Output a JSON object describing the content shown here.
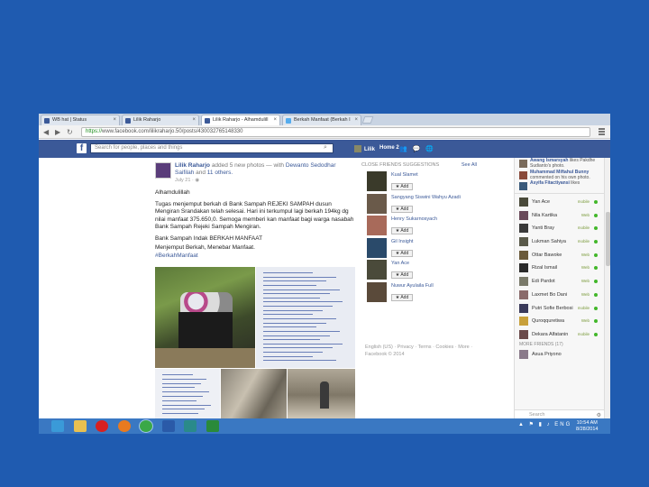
{
  "browser": {
    "tabs": [
      {
        "title": "WB hat | Status",
        "active": false
      },
      {
        "title": "Lilik Raharjo",
        "active": false
      },
      {
        "title": "Lilik Raharjo - Alhamdulill",
        "active": true
      },
      {
        "title": "Berkah Manfaat (Berkah I",
        "active": false
      }
    ],
    "url_scheme": "https://",
    "url_rest": "www.facebook.com/lilikraharjo.50/posts/430032765148330"
  },
  "fb_header": {
    "logo": "f",
    "search_placeholder": "Search for people, places and things",
    "user": "Lilik",
    "home": "Home",
    "home_count": "2"
  },
  "post": {
    "author": "Lilik Raharjo",
    "action": " added 5 new photos — with ",
    "with": "Dewanto Sedodhar Saifilah",
    "and": " and ",
    "others": "11 others.",
    "time": "July 21 · ",
    "paragraphs": [
      "Alhamdulillah",
      "Tugas menjemput berkah di Bank Sampah REJEKI SAMPAH dusun Mengiran Srandakan telah selesai. Hari ini terkumpul lagi berkah 194kg dg nilai manfaat 375.650,0. Semoga memberi kan manfaat bagi warga nasabah Bank Sampah Rejeki Sampah Mengiran.",
      "Bank Sampah Indak BERKAH MANFAAT",
      "Menjemput Berkah, Menebar Manfaat."
    ],
    "hashtag": "#BerkahManfaat"
  },
  "suggestions": {
    "title": "CLOSE FRIENDS SUGGESTIONS",
    "see_all": "See All",
    "add_label": "Add",
    "people": [
      {
        "name": "Kual Slamet",
        "color": "#3a3a2a"
      },
      {
        "name": "Sangyang Siswini Wahyu Azadi",
        "color": "#6a5a4a"
      },
      {
        "name": "Henry Sukarnosyach",
        "color": "#a86a5a"
      },
      {
        "name": "Gil Insight",
        "color": "#2a4a6a"
      },
      {
        "name": "Yan Ace",
        "color": "#4a4a3a"
      },
      {
        "name": "Nuwur Ayulaila Full",
        "color": "#5a4a3a"
      }
    ],
    "footer": "English (US) · Privacy · Terms · Cookies · More · Facebook © 2014"
  },
  "chat": {
    "ticker": [
      {
        "name": "Awang Ismarsyah",
        "text": " likes Pakdhe Sudianto's photo.",
        "color": "#7a6a5a"
      },
      {
        "name": "Muhammad Miftahul Bunny",
        "text": " commented on his own photo.",
        "color": "#8a4a3a"
      },
      {
        "name": "Asyifa Fitactiyansi",
        "text": " likes",
        "color": "#3a5a7a"
      }
    ],
    "friends": [
      {
        "name": "Yan Ace",
        "status": "mobile",
        "color": "#4a4a3a"
      },
      {
        "name": "Nila Kartika",
        "status": "Web",
        "color": "#6a4a5a"
      },
      {
        "name": "Yanti Bray",
        "status": "mobile",
        "color": "#3a3a3a"
      },
      {
        "name": "Lukman Sahiya",
        "status": "mobile",
        "color": "#5a5a4a"
      },
      {
        "name": "Ottar Bawoke",
        "status": "Web",
        "color": "#6a5a3a"
      },
      {
        "name": "Rizal Ismail",
        "status": "Web",
        "color": "#2a2a2a"
      },
      {
        "name": "Edi Pardot",
        "status": "Web",
        "color": "#7a7a6a"
      },
      {
        "name": "Laxmet Bo Dani",
        "status": "Web",
        "color": "#8a6a6a"
      },
      {
        "name": "Putri Sofie Berbosi",
        "status": "mobile",
        "color": "#3a3a5a"
      },
      {
        "name": "Quroqquretiwa",
        "status": "Web",
        "color": "#c8a03a"
      },
      {
        "name": "Dekara Alfatanin",
        "status": "mobile",
        "color": "#6a4a4a"
      }
    ],
    "more_friends": "MORE FRIENDS (17)",
    "extra": {
      "name": "Asua Priyono",
      "color": "#8a7a8a"
    },
    "search": "Search"
  },
  "taskbar": {
    "apps": [
      {
        "name": "internet-explorer-icon",
        "color": "#3a9ad8"
      },
      {
        "name": "file-explorer-icon",
        "color": "#e8c050"
      },
      {
        "name": "opera-icon",
        "color": "#d82020"
      },
      {
        "name": "firefox-icon",
        "color": "#e87a20"
      },
      {
        "name": "chrome-icon",
        "color": "#3aa848"
      },
      {
        "name": "word-icon",
        "color": "#2a5aa8"
      },
      {
        "name": "publisher-icon",
        "color": "#2a8a8a"
      },
      {
        "name": "excel-icon",
        "color": "#2a8a3a"
      }
    ],
    "lang": "ENG",
    "time": "10:54 AM",
    "date": "8/28/2014"
  }
}
